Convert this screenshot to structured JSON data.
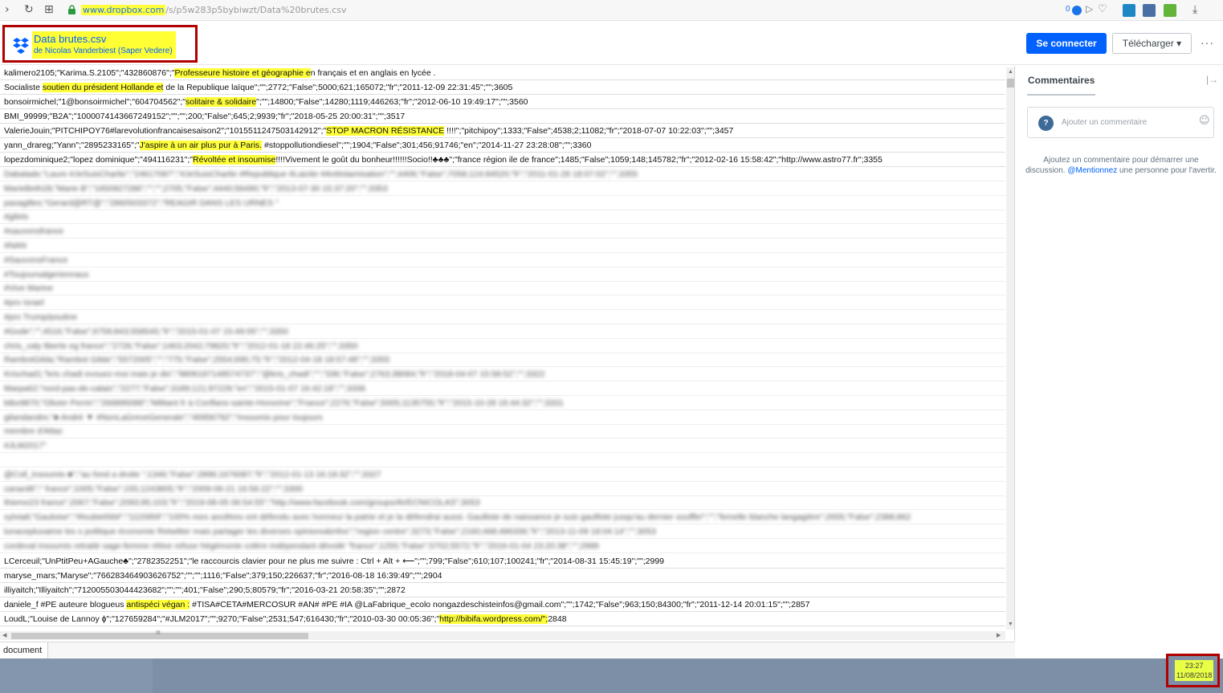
{
  "browser": {
    "url_host": "www.dropbox.com",
    "url_path": "/s/p5w283p5bybiwzt/Data%20brutes.csv",
    "nav_forward": "›",
    "nav_reload": "↻",
    "nav_apps": "⊞",
    "badge_count": "0",
    "icons": [
      "forward-icon",
      "reload-icon",
      "apps-icon",
      "lock-icon",
      "extension-icon",
      "bookmark-icon",
      "download-icon"
    ]
  },
  "header": {
    "file_title": "Data brutes.csv",
    "file_owner": "de Nicolas Vanderbiest (Saper Vedere)",
    "connect_label": "Se connecter",
    "download_label": "Télécharger ▾",
    "more_label": "···"
  },
  "csv": {
    "top_rows": [
      {
        "segments": [
          {
            "t": "kalimero2105;\"Karima.S.2105\";\"432860876\";\""
          },
          {
            "t": "Professeure histoire et géographie e",
            "hl": true
          },
          {
            "t": "n français et en anglais en lycée ."
          }
        ]
      },
      {
        "segments": [
          {
            "t": "Socialiste    "
          },
          {
            "t": "soutien du président Hollande et",
            "hl": true
          },
          {
            "t": " de la Republique laïque\";\"\";2772;\"False\";5000;621;165072;\"fr\";\"2011-12-09 22:31:45\";\"\";3605"
          }
        ]
      },
      {
        "segments": [
          {
            "t": "bonsoirmichel;\"1@bonsoirmichel\";\"604704562\";\""
          },
          {
            "t": "solitaire & solidaire",
            "hl": true
          },
          {
            "t": "\";\"\";14800;\"False\";14280;1119;446263;\"fr\";\"2012-06-10 19:49:17\";\"\";3560"
          }
        ]
      },
      {
        "segments": [
          {
            "t": "BMI_99999;\"B2A\";\"1000074143667249152\";\"\";\"\";200;\"False\";645;2;9939;\"fr\";\"2018-05-25 20:00:31\";\"\";3517"
          }
        ]
      },
      {
        "segments": [
          {
            "t": "ValerieJouin;\"PITCHIPOY76#larevolutionfrancaisesaison2\";\"1015511247503142912\";\""
          },
          {
            "t": "STOP MACRON RÉSISTANCE",
            "hl": true
          },
          {
            "t": " !!!!\";\"pitchipoy\";1333;\"False\";4538;2;11082;\"fr\";\"2018-07-07 10:22:03\";\"\";3457"
          }
        ]
      },
      {
        "segments": [
          {
            "t": "yann_drareg;\"Yann\";\"2895233165\";\""
          },
          {
            "t": "J'aspire à un air plus pur à Paris.",
            "hl": true
          },
          {
            "t": " #stoppollutiondiesel\";\"\";1904;\"False\";301;456;91746;\"en\";\"2014-11-27 23:28:08\";\"\";3360"
          }
        ]
      },
      {
        "segments": [
          {
            "t": "lopezdominique2;\"lopez dominique\";\"494116231\";\""
          },
          {
            "t": "Révoltée et insoumise",
            "hl": true
          },
          {
            "t": "!!!!Vivement le goût du bonheur!!!!!!Socio!!♣♣♣\";\"france région  ile de france\";1485;\"False\";1059;148;145782;\"fr\";\"2012-02-16 15:58:42\";\"http://www.astro77.fr\";3355"
          }
        ]
      }
    ],
    "blurred_rows": [
      "Dabalade;\"Laure #JeSuisCharlie\";\"24617087\";\"#JeSuisCharlie #Republique #Laicite #AntiIslamisation\";\"\";4406;\"False\";7058;124;94520;\"fr\";\"2011-01-28 18:07:02\";\"\";3355",
      "MarieBeth28;\"Marie B\";\"1650927286\";\"\";\"\";2705;\"False\";4440;56490;\"fr\";\"2013-07-30 15:37:20\";\"\";3353",
      "paxagilles;\"Gerard@RT@\";\"2860503372\";\"REAGIR DANS LES URNES \"",
      "#gilets",
      "#sauvonsfrance",
      "#NAN",
      "#SauvonsFrance",
      "#Toujoursalgeriennaux",
      "#Vive Marine",
      "#pro Israel",
      "#pro Trump/poutine",
      "#Gode\";\"\";4516;\"False\";6759;843;558545;\"fr\";\"2015-01-07 15:49:05\";\"\";3350",
      "chris_valy  liberte eg  france\";\"2726;\"False\";1463;2042;79820;\"fr\";\"2012-01-18 22:46:25\";\"\";3350",
      "RambotGilda;\"Rambot Gilda\";\"5572005\";\"\";\"775;\"False\";2554;695;75;\"fr\";\"2012-04-18 18:57:48\";\"\";3355",
      "Krischad1;\"kris chadi evouez-moi mais je dis\";\"9806187148574737\";\"@kris_chadi\";\"\";\"336;\"False\";2763;38084;\"fr\";\"2018-04-07 15:58:52\";\"\";3322",
      "Marpa62;\"nord-pas-de-calais\";\"2277;\"False\";3189;121;97229;\"en\";\"2015-01-07 16:42:18\";\"\";3336",
      "btbx9870;\"Olivier Perrin\";\"266895088\";\"Militant fr à Conflans-sainte-Honorine\";\"France\";2276;\"False\";5005;1135755;\"fr\";\"2015-10-28 16:44:32\";\"\";3331",
      "gilandandre;\"♣ André ▼ #NonLaGreveGenerale\";\"46956792\";\"insoumis pour toujours",
      "membre d'Attac",
      "#JLM2017\"",
      "",
      "@Coll_insoumis ♣\";\"au fond a droite \";1346;\"False\";2896;1676087;\"fr\";\"2012-01-13 16:18:32\";\"\";3327",
      "canard6\";\"  france\";1005;\"False\";155;1243805;\"fr\";\"2009-06-21 16:56:22\";\"\";3300",
      "thiemo23   france\";2067;\"False\";2093;95;103;\"fr\";\"2019-08-05 06:54:55\";\"http://www.facebook.com/groups/AVECNICOLAS\";3053",
      "sylvia8;\"Gauloise\";\"#loubiet56#\";\"1115959\";\"100% mes ancêtres ont défendu avec honneur la patrie et je la défendrai aussi. Gaulliste de naissance je suis gaulliste jusqu'au dernier souffle!\";\"\";\"femelle blanche langagière\";2655;\"False\";2388;862",
      "lunaceplusaime les s  politique  économie  Retwitter  mais partager les diverses opinions&infos\";\"region centre\";3273;\"False\";2160;468;486336;\"fr\";\"2013-11-09 18:04:14\";\"\";3053",
      "cordeval   insoumis   retraité   sage-femme  rétive   refuse hégémonie   colère   indépendant  dévoilé  \"france\";1255;\"False\";5702;5572;\"fr\";\"2016-01-04 23:20:38\";\"\";2999"
    ],
    "bottom_rows": [
      {
        "segments": [
          {
            "t": "LCerceuil;\"UnPtitPeu+AGauche♣\";\"2782352251\";\"le raccourcis clavier pour ne plus me suivre : Ctrl + Alt + ⟵\";\"\";799;\"False\";610;107;100241;\"fr\";\"2014-08-31 15:45:19\";\"\";2999"
          }
        ]
      },
      {
        "segments": [
          {
            "t": "maryse_mars;\"Maryse\";\"766283464903626752\";\"\";\"\";1116;\"False\";379;150;226637;\"fr\";\"2016-08-18 16:39:49\";\"\";2904"
          }
        ]
      },
      {
        "segments": [
          {
            "t": "illiyaitch;\"Illiyaitch\";\"712005503044423682\";\"\";\"\";401;\"False\";290;5;80579;\"fr\";\"2016-03-21 20:58:35\";\"\";2872"
          }
        ]
      },
      {
        "segments": [
          {
            "t": "daniele_f   #PE      auteure     blogueus  "
          },
          {
            "t": " antispéci   végan  :",
            "hl": true
          },
          {
            "t": " #TISA#CETA#MERCOSUR #AN# #PE #IA @LaFabrique_ecolo  nongazdeschisteinfos@gmail.com\";\"\";1742;\"False\";963;150;84300;\"fr\";\"2011-12-14 20:01:15\";\"\";2857"
          }
        ]
      },
      {
        "segments": [
          {
            "t": "LoudL;\"Louise de Lannoy ɸ\";\"127659284\";\"#JLM2017\";\"\";9270;\"False\";2531;547;616430;\"fr\";\"2010-03-30 00:05:36\";\""
          },
          {
            "t": "http://bibifa.wordpress.com/\";",
            "hl": true
          },
          {
            "t": "2848"
          }
        ]
      }
    ],
    "hscroll_grip": "III",
    "sheet_tab": "document"
  },
  "comments": {
    "title": "Commentaires",
    "collapse": "|→",
    "input_placeholder": "Ajouter un commentaire",
    "help": "?",
    "emoji": "☺",
    "hint_before": "Ajoutez un commentaire pour démarrer une discussion. ",
    "hint_mention": "@Mentionnez",
    "hint_after": " une personne pour l'avertir."
  },
  "taskbar": {
    "time": "23:27",
    "date": "11/08/2018"
  },
  "colors": {
    "dropbox_blue": "#0061fe",
    "highlight": "#ffff3a",
    "annotation_red": "#b00000",
    "taskbar": "#7d8fa7"
  }
}
